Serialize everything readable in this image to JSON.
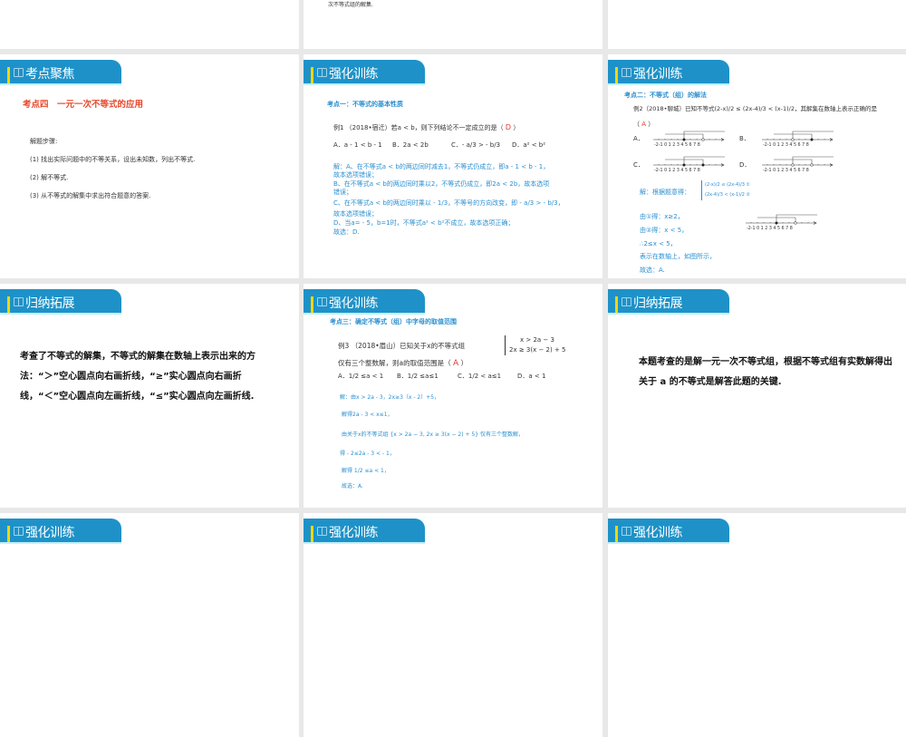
{
  "row1": {
    "slide2_text": "次不等式组的解集."
  },
  "headers": {
    "kaodian": "考点聚焦",
    "qianghua": "强化训练",
    "guina": "归纳拓展"
  },
  "s4": {
    "heading": "考点四　一元一次不等式的应用",
    "lines": [
      "解题步骤:",
      "(1) 找出实际问题中的不等关系，设出未知数，列出不等式.",
      "(2) 解不等式.",
      "(3) 从不等式的解集中求出符合题意的答案."
    ]
  },
  "s5": {
    "heading": "考点一：不等式的基本性质",
    "question": "例1 （2018•宿迁）若a < b，则下列结论不一定成立的是（",
    "answer": "D",
    "close": "）",
    "options": [
      "A．a - 1 < b - 1",
      "B．2a < 2b",
      "C．- a/3 > - b/3",
      "D．a² < b²"
    ],
    "solution": [
      "解：A、在不等式a < b的两边同时减去1，不等式仍成立，即a - 1 < b - 1，",
      "故本选项错误；",
      "B、在不等式a < b的两边同时乘以2，不等式仍成立，即2a < 2b，故本选项",
      "错误；",
      "C、在不等式a < b的两边同时乘以 - 1/3，不等号的方向改变，即 - a/3 > - b/3，",
      "故本选项错误；",
      "D、当a= - 5，b=1时，不等式a² < b²不成立，故本选项正确；",
      "故选：D."
    ]
  },
  "s6": {
    "heading": "考点二：不等式（组）的解法",
    "question": "例2（2018•聊城）已知不等式(2-x)/2 ≤ (2x-4)/3 < (x-1)/2，其解集在数轴上表示正确的是",
    "answer_line": "（",
    "answer": "A",
    "answer_close": "）",
    "option_labels": [
      "A．",
      "B．",
      "C．",
      "D．"
    ],
    "ticks": "-2-1 0 1 2 3 4 5 6 7 8",
    "option_dots": [
      [
        "solid",
        "hollow"
      ],
      [
        "hollow",
        "solid"
      ],
      [
        "solid",
        "solid"
      ],
      [
        "hollow",
        "hollow"
      ]
    ],
    "solution_prefix": "解：根据题意得：",
    "system": [
      "(2-x)/2 ≤ (2x-4)/3 ①",
      "(2x-4)/3 < (x-1)/2 ②"
    ],
    "solution": [
      "由①得：x≥2，",
      "由②得：x < 5，",
      "∴2≤x < 5，",
      "表示在数轴上，如图所示，",
      "故选：A."
    ]
  },
  "s7": {
    "text": "考查了不等式的解集，不等式的解集在数轴上表示出来的方法：“＞”空心圆点向右画折线，“≥”实心圆点向右画折线，“＜”空心圆点向左画折线，“≤”实心圆点向左画折线."
  },
  "s8": {
    "heading": "考点三：确定不等式（组）中字母的取值范围",
    "question": "例3 （2018•眉山）已知关于x的不等式组",
    "system": [
      "x > 2a − 3",
      "2x ≥ 3(x − 2) + 5"
    ],
    "question2": "仅有三个整数解，则a的取值范围是（",
    "answer": "A",
    "close": "）",
    "options": [
      "A．1/2 ≤a < 1",
      "B．1/2 ≤a≤1",
      "C．1/2 < a≤1",
      "D．a < 1"
    ],
    "solution": [
      "解：由x > 2a - 3，2x≥3（x - 2）+5，",
      "解得2a - 3 < x≤1，",
      "由关于x的不等式组 {x > 2a − 3, 2x ≥ 3(x − 2) + 5} 仅有三个整数解，",
      "得 - 2≤2a - 3 < - 1，",
      "解得 1/2 ≤a < 1，",
      "故选：A."
    ]
  },
  "s9": {
    "text": "本题考查的是解一元一次不等式组，根据不等式组有实数解得出关于 a 的不等式是解答此题的关键."
  }
}
